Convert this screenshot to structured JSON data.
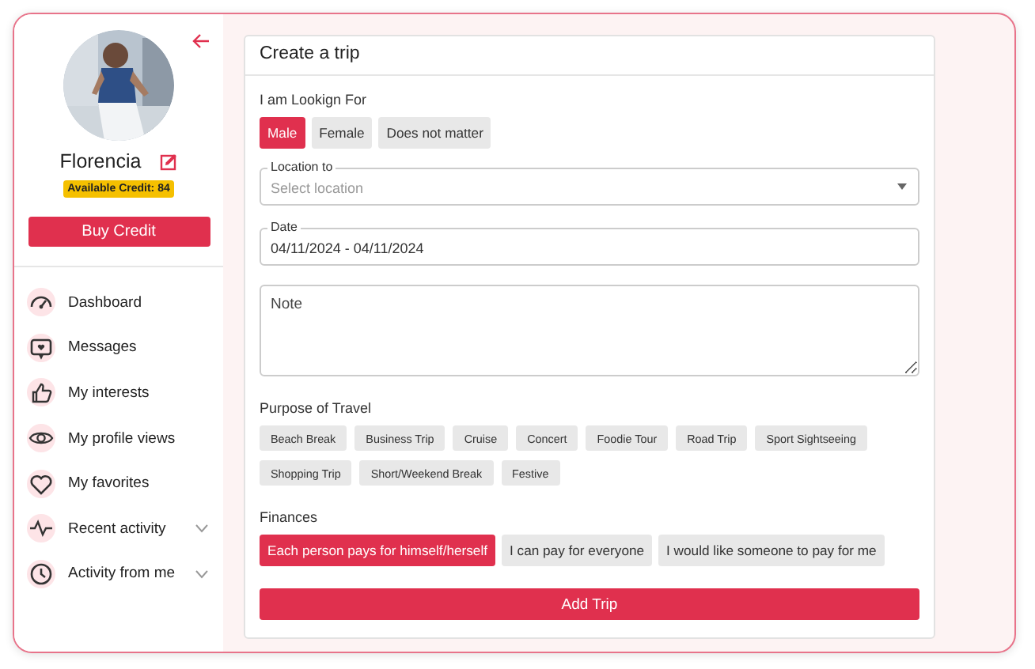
{
  "profile": {
    "name": "Florencia",
    "credit_badge": "Available Credit: 84",
    "buy_button": "Buy Credit"
  },
  "menu": [
    {
      "label": "Dashboard",
      "kind": "link"
    },
    {
      "label": "Messages",
      "kind": "link"
    },
    {
      "label": "My interests",
      "kind": "link"
    },
    {
      "label": "My profile views",
      "kind": "link"
    },
    {
      "label": "My favorites",
      "kind": "link"
    },
    {
      "label": "Recent activity",
      "kind": "group",
      "expanded": false
    },
    {
      "label": "Activity from me",
      "kind": "group",
      "expanded": false
    }
  ],
  "form": {
    "title": "Create a trip",
    "looking_for": {
      "label": "I am Lookign For",
      "options": [
        {
          "label": "Male",
          "selected": true
        },
        {
          "label": "Female",
          "selected": false
        },
        {
          "label": "Does not matter",
          "selected": false
        }
      ]
    },
    "location": {
      "label": "Location to",
      "placeholder": "Select location"
    },
    "date": {
      "label": "Date",
      "value": "04/11/2024 - 04/11/2024"
    },
    "note": {
      "placeholder": "Note"
    },
    "purpose": {
      "label": "Purpose of Travel",
      "options": [
        {
          "label": "Beach Break",
          "selected": false
        },
        {
          "label": "Business Trip",
          "selected": false
        },
        {
          "label": "Cruise",
          "selected": false
        },
        {
          "label": "Concert",
          "selected": false
        },
        {
          "label": "Foodie Tour",
          "selected": false
        },
        {
          "label": "Road Trip",
          "selected": false
        },
        {
          "label": "Sport Sightseeing",
          "selected": false
        },
        {
          "label": "Shopping Trip",
          "selected": false
        },
        {
          "label": "Short/Weekend Break",
          "selected": false
        },
        {
          "label": "Festive",
          "selected": false
        }
      ]
    },
    "finances": {
      "label": "Finances",
      "options": [
        {
          "label": "Each person pays for himself/herself",
          "selected": true
        },
        {
          "label": "I can pay for everyone",
          "selected": false
        },
        {
          "label": "I would like someone to pay for me",
          "selected": false
        }
      ]
    },
    "submit": "Add Trip"
  }
}
